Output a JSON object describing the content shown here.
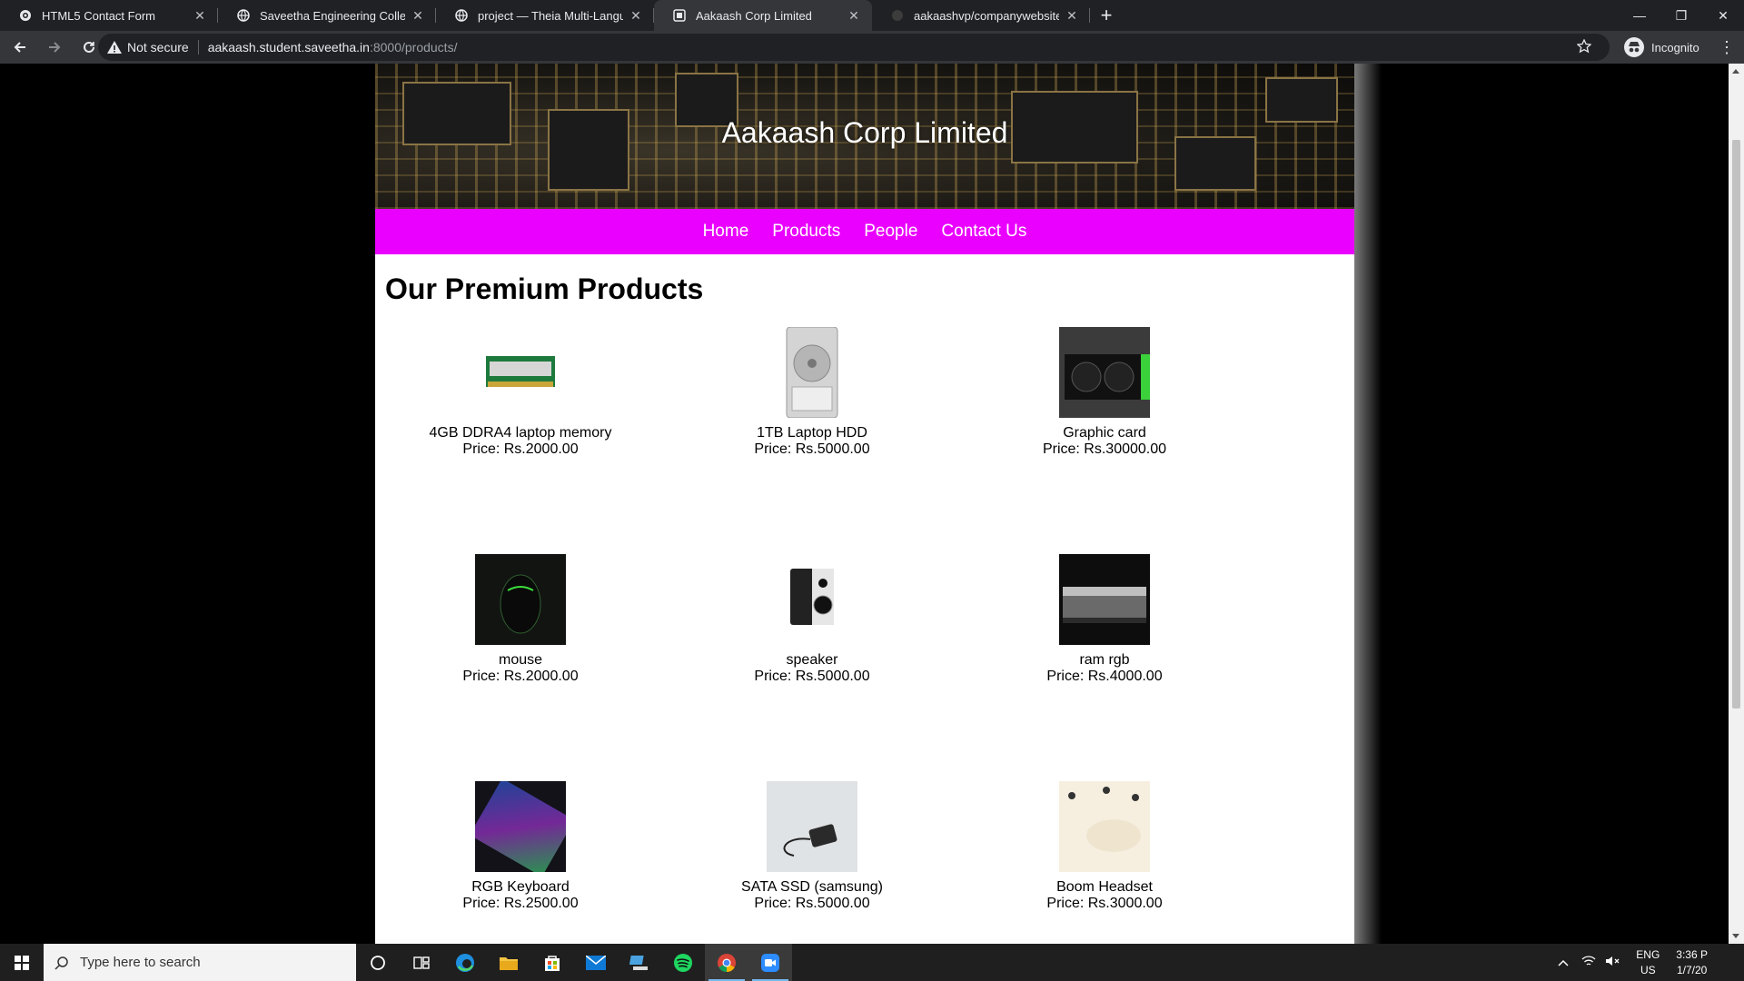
{
  "browser": {
    "tabs": [
      {
        "title": "HTML5 Contact Form",
        "icon": "gear-icon",
        "active": false
      },
      {
        "title": "Saveetha Engineering College",
        "icon": "globe-icon",
        "active": false
      },
      {
        "title": "project — Theia Multi-Language",
        "icon": "globe-icon",
        "active": false
      },
      {
        "title": "Aakaash Corp Limited",
        "icon": "page-icon",
        "active": true
      },
      {
        "title": "aakaashvp/companywebsite",
        "icon": "github-icon",
        "active": false
      }
    ],
    "security_label": "Not secure",
    "url_host": "aakaash.student.saveetha.in",
    "url_path": ":8000/products/",
    "profile_label": "Incognito"
  },
  "site": {
    "brand": "Aakaash Corp Limited",
    "nav": [
      "Home",
      "Products",
      "People",
      "Contact Us"
    ],
    "heading": "Our Premium Products",
    "products": [
      {
        "name": "4GB DDRA4 laptop memory",
        "price": "Price: Rs.2000.00",
        "image": "ram-stick"
      },
      {
        "name": "1TB Laptop HDD",
        "price": "Price: Rs.5000.00",
        "image": "hdd"
      },
      {
        "name": "Graphic card",
        "price": "Price: Rs.30000.00",
        "image": "gpu"
      },
      {
        "name": "mouse",
        "price": "Price: Rs.2000.00",
        "image": "mouse"
      },
      {
        "name": "speaker",
        "price": "Price: Rs.5000.00",
        "image": "speaker"
      },
      {
        "name": "ram rgb",
        "price": "Price: Rs.4000.00",
        "image": "ram-rgb"
      },
      {
        "name": "RGB Keyboard",
        "price": "Price: Rs.2500.00",
        "image": "keyboard"
      },
      {
        "name": "SATA SSD (samsung)",
        "price": "Price: Rs.5000.00",
        "image": "ssd"
      },
      {
        "name": "Boom Headset",
        "price": "Price: Rs.3000.00",
        "image": "headset"
      }
    ]
  },
  "taskbar": {
    "search_placeholder": "Type here to search",
    "lang_line1": "ENG",
    "lang_line2": "US",
    "time": "3:36 P",
    "date": "1/7/20"
  }
}
